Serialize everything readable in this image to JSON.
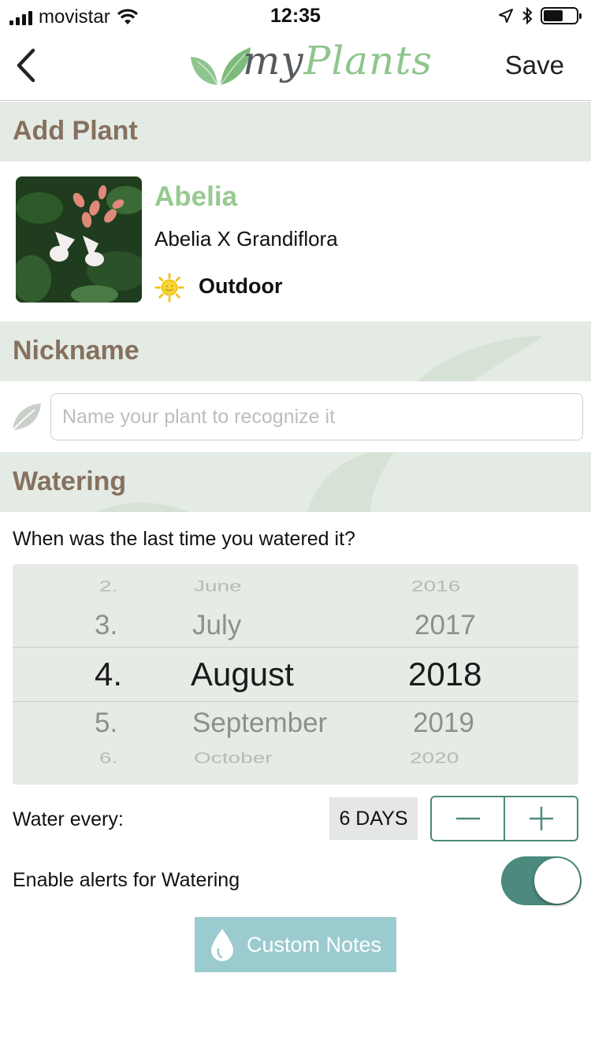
{
  "status_bar": {
    "carrier": "movistar",
    "time": "12:35",
    "icons": [
      "signal-icon",
      "wifi-icon",
      "location-icon",
      "bluetooth-icon",
      "battery-icon"
    ]
  },
  "nav": {
    "back_icon": "chevron-left-icon",
    "logo_my": "my",
    "logo_plants": "Plants",
    "save_label": "Save"
  },
  "add_plant": {
    "header": "Add Plant",
    "plant": {
      "name": "Abelia",
      "scientific_name": "Abelia X Grandiflora",
      "environment": "Outdoor",
      "environment_icon": "sun-icon"
    }
  },
  "nickname": {
    "header": "Nickname",
    "placeholder": "Name your plant to recognize it",
    "value": "",
    "icon": "leaf-icon"
  },
  "watering": {
    "header": "Watering",
    "question": "When was the last time you watered it?",
    "picker": {
      "day": {
        "far_above": "2.",
        "above": "3.",
        "selected": "4.",
        "below": "5.",
        "far_below": "6."
      },
      "month": {
        "far_above": "June",
        "above": "July",
        "selected": "August",
        "below": "September",
        "far_below": "October"
      },
      "year": {
        "far_above": "2016",
        "above": "2017",
        "selected": "2018",
        "below": "2019",
        "far_below": "2020"
      }
    },
    "water_every_label": "Water every:",
    "interval": "6 DAYS",
    "stepper_icons": [
      "minus-icon",
      "plus-icon"
    ],
    "alerts_label": "Enable alerts for Watering",
    "alerts_enabled": true,
    "custom_notes_label": "Custom Notes",
    "custom_notes_icon": "water-drop-icon"
  },
  "colors": {
    "brand_green": "#97c990",
    "header_brown": "#85715e",
    "section_bg": "#e4ebe4",
    "accent_teal": "#4b8a7c",
    "notes_button": "#9bcbcf"
  }
}
